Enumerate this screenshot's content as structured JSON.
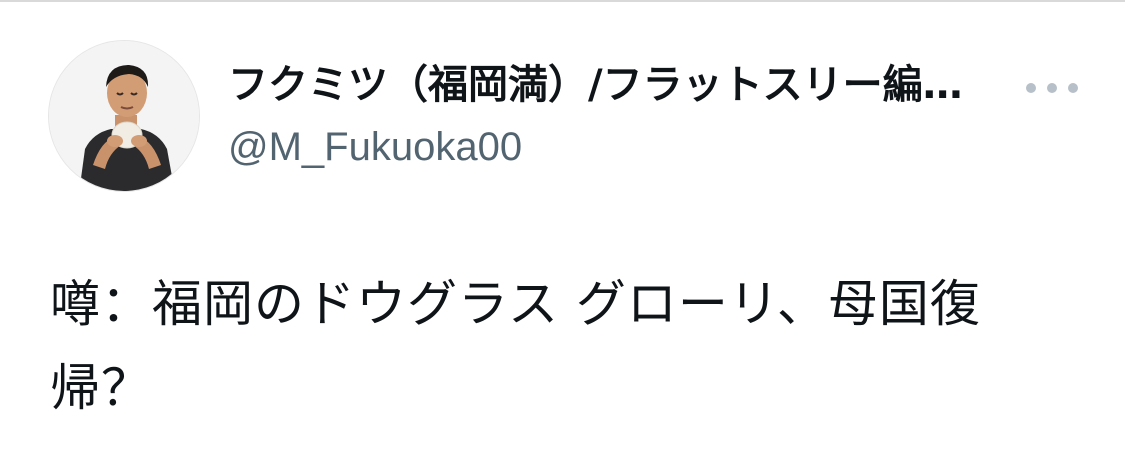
{
  "tweet": {
    "author": {
      "display_name": "フクミツ（福岡満）/フラットスリー編…",
      "handle": "@M_Fukuoka00",
      "avatar_icon": "person-avatar-icon"
    },
    "more_icon": "more-options-icon",
    "text": "噂：福岡のドウグラス グローリ、母国復帰？"
  },
  "colors": {
    "text_primary": "#0f1419",
    "text_secondary": "#536471",
    "more_dots": "#b7c0c8",
    "background": "#ffffff"
  }
}
